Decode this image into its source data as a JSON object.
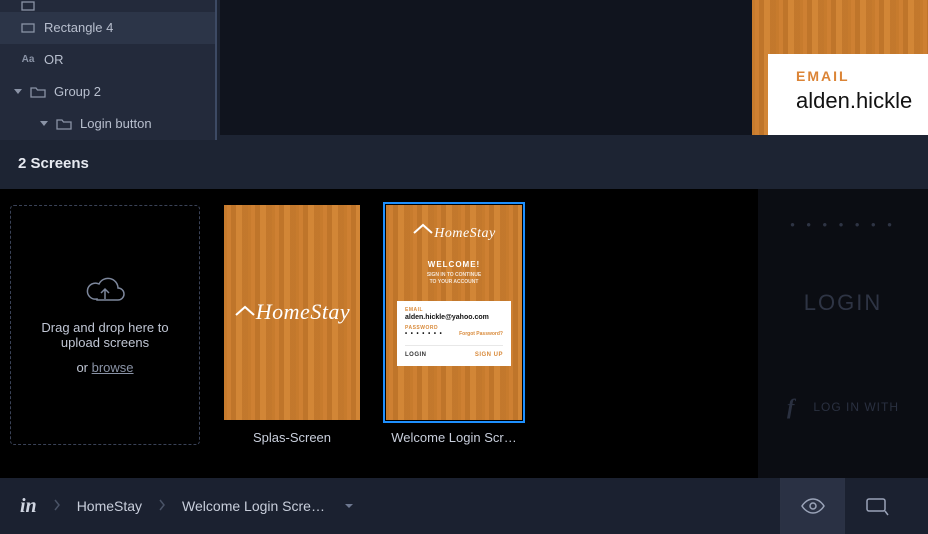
{
  "sidebar": {
    "layers": [
      {
        "name": "Rectangle 4",
        "type": "rect",
        "selected": true,
        "indent": 1
      },
      {
        "name": "OR",
        "type": "text",
        "selected": false,
        "indent": 1
      },
      {
        "name": "Group 2",
        "type": "folder",
        "selected": false,
        "indent": 0,
        "expanded": true
      },
      {
        "name": "Login button",
        "type": "folder",
        "selected": false,
        "indent": 2,
        "expanded": true
      }
    ]
  },
  "preview": {
    "email_label": "EMAIL",
    "email_value": "alden.hickle"
  },
  "screens": {
    "header": "2 Screens",
    "upload_line1": "Drag and drop here to",
    "upload_line2": "upload screens",
    "upload_or": "or ",
    "upload_browse": "browse",
    "items": [
      {
        "label": "Splas-Screen",
        "selected": false,
        "kind": "splash"
      },
      {
        "label": "Welcome Login Scr…",
        "selected": true,
        "kind": "login"
      }
    ],
    "logo_text": "HomeStay",
    "login_thumb": {
      "welcome": "WELCOME!",
      "email_label": "EMAIL",
      "email_value": "alden.hickle@yahoo.com",
      "password_label": "PASSWORD",
      "password_dots": "• • • • • • •",
      "forgot": "Forgot Password?",
      "login_btn": "LOGIN",
      "signup_btn": "SIGN UP"
    }
  },
  "ghost": {
    "dots": "• • • • • • •",
    "login": "LOGIN",
    "fb": "LOG IN WITH"
  },
  "breadcrumb": {
    "project": "HomeStay",
    "screen": "Welcome Login Scre…"
  }
}
